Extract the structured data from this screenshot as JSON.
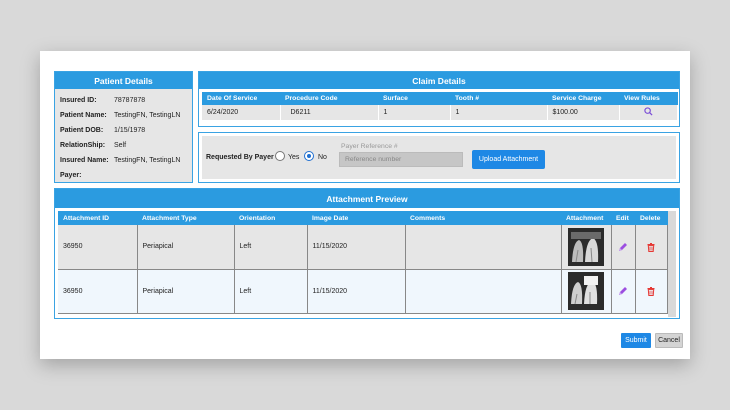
{
  "patient": {
    "title": "Patient Details",
    "rows": [
      {
        "label": "Insured ID:",
        "value": "78787878"
      },
      {
        "label": "Patient Name:",
        "value": "TestingFN, TestingLN"
      },
      {
        "label": "Patient DOB:",
        "value": "1/15/1978"
      },
      {
        "label": "RelationShip:",
        "value": "Self"
      },
      {
        "label": "Insured Name:",
        "value": "TestingFN, TestingLN"
      },
      {
        "label": "Payer:",
        "value": ""
      }
    ]
  },
  "claim": {
    "title": "Claim Details",
    "columns": [
      "Date Of Service",
      "Procedure Code",
      "Surface",
      "Tooth #",
      "Service Charge",
      "View Rules"
    ],
    "row": {
      "date": "6/24/2020",
      "code": "D6211",
      "surface": "1",
      "tooth": "1",
      "charge": "$100.00"
    }
  },
  "payer": {
    "requested_label": "Requested By Payer",
    "yes_label": "Yes",
    "no_label": "No",
    "selected": "No",
    "ref_label": "Payer Reference #",
    "ref_placeholder": "Reference number",
    "upload_label": "Upload Attachment"
  },
  "attachments": {
    "title": "Attachment Preview",
    "columns": [
      "Attachment ID",
      "Attachment Type",
      "Orientation",
      "Image Date",
      "Comments",
      "Attachment",
      "Edit",
      "Delete"
    ],
    "rows": [
      {
        "id": "36950",
        "type": "Periapical",
        "orientation": "Left",
        "date": "11/15/2020",
        "comments": ""
      },
      {
        "id": "36950",
        "type": "Periapical",
        "orientation": "Left",
        "date": "11/15/2020",
        "comments": ""
      }
    ]
  },
  "footer": {
    "submit_label": "Submit",
    "cancel_label": "Cancel"
  },
  "colors": {
    "accent": "#2b9be0",
    "button": "#1e88e5",
    "edit_icon": "#9c4ee0",
    "delete_icon": "#e53935"
  }
}
